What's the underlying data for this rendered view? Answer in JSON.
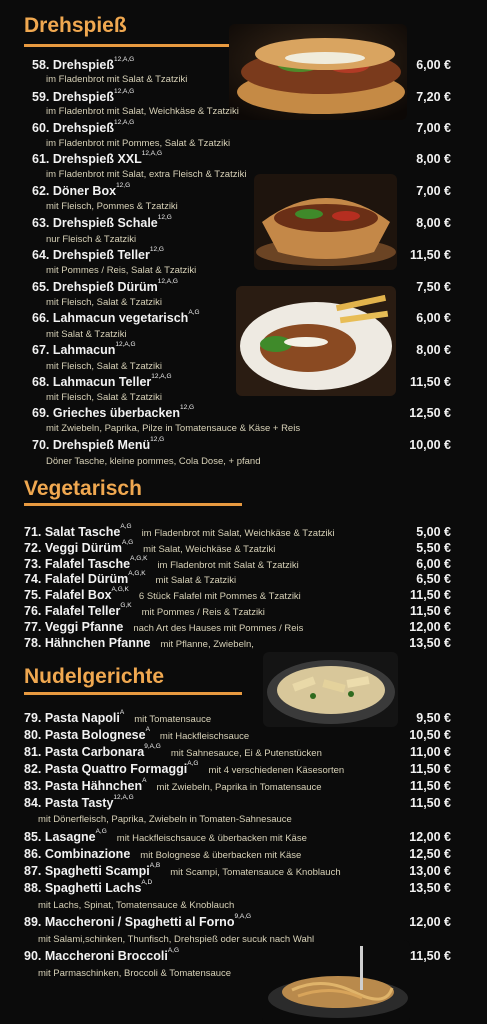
{
  "sections": {
    "drehspiess": "Drehspieß",
    "vegetarisch": "Vegetarisch",
    "nudel": "Nudelgerichte"
  },
  "items": [
    {
      "name": "58. Drehspieß",
      "sup": "12,A,G",
      "desc": "im Fladenbrot mit Salat & Tzatziki",
      "price": "6,00 €"
    },
    {
      "name": "59. Drehspieß",
      "sup": "12,A,G",
      "desc": "im Fladenbrot mit Salat, Weichkäse & Tzatziki",
      "price": "7,20 €"
    },
    {
      "name": "60. Drehspieß",
      "sup": "12,A,G",
      "desc": "im Fladenbrot mit Pommes, Salat & Tzatziki",
      "price": "7,00 €"
    },
    {
      "name": "61. Drehspieß XXL",
      "sup": "12,A,G",
      "desc": "im Fladenbrot mit Salat, extra Fleisch & Tzatziki",
      "price": "8,00 €"
    },
    {
      "name": "62. Döner Box",
      "sup": "12,G",
      "desc": "mit Fleisch, Pommes & Tzatziki",
      "price": "7,00 €"
    },
    {
      "name": "63. Drehspieß Schale",
      "sup": "12,G",
      "desc": "nur Fleisch & Tzatziki",
      "price": "8,00 €"
    },
    {
      "name": "64. Drehspieß Teller",
      "sup": "12,G",
      "desc": "mit Pommes / Reis, Salat & Tzatziki",
      "price": "11,50 €"
    },
    {
      "name": "65. Drehspieß Dürüm",
      "sup": "12,A,G",
      "desc": "mit Fleisch, Salat & Tzatziki",
      "price": "7,50 €"
    },
    {
      "name": "66. Lahmacun vegetarisch",
      "sup": "A,G",
      "desc": "mit Salat & Tzatziki",
      "price": "6,00 €"
    },
    {
      "name": "67. Lahmacun",
      "sup": "12,A,G",
      "desc": "mit Fleisch, Salat & Tzatziki",
      "price": "8,00 €"
    },
    {
      "name": "68. Lahmacun Teller",
      "sup": "12,A,G",
      "desc": "mit Fleisch, Salat & Tzatziki",
      "price": "11,50 €"
    },
    {
      "name": "69. Grieches überbacken",
      "sup": "12,G",
      "desc": "mit Zwiebeln, Paprika, Pilze in Tomatensauce & Käse + Reis",
      "price": "12,50 €"
    },
    {
      "name": "70. Drehspieß Menü",
      "sup": "12,G",
      "desc": "Döner Tasche, kleine pommes, Cola Dose, + pfand",
      "price": "10,00 €"
    },
    {
      "name": "71. Salat Tasche",
      "sup": "A,G",
      "desc": "im Fladenbrot mit Salat, Weichkäse & Tzatziki",
      "price": "5,00 €"
    },
    {
      "name": "72. Veggi Dürüm",
      "sup": "A,G",
      "desc": "mit Salat, Weichkäse & Tzatziki",
      "price": "5,50 €"
    },
    {
      "name": "73. Falafel Tasche",
      "sup": "A,G,K",
      "desc": "im Fladenbrot mit Salat & Tzatziki",
      "price": "6,00 €"
    },
    {
      "name": "74. Falafel Dürüm",
      "sup": "A,G,K",
      "desc": "mit Salat & Tzatziki",
      "price": "6,50 €"
    },
    {
      "name": "75. Falafel Box",
      "sup": "A,G,K",
      "desc": "6 Stück Falafel mit Pommes & Tzatziki",
      "price": "11,50 €"
    },
    {
      "name": "76. Falafel Teller",
      "sup": "G,K",
      "desc": "mit Pommes / Reis & Tzatziki",
      "price": "11,50 €"
    },
    {
      "name": "77. Veggi Pfanne",
      "sup": "",
      "desc": "nach Art des Hauses mit Pommes / Reis",
      "price": "12,00 €"
    },
    {
      "name": "78. Hähnchen Pfanne",
      "sup": "",
      "desc": "mit Pflanne, Zwiebeln,",
      "price": "13,50 €"
    },
    {
      "name": "79. Pasta Napoli",
      "sup": "A",
      "desc": "mit Tomatensauce",
      "price": "9,50 €"
    },
    {
      "name": "80. Pasta Bolognese",
      "sup": "A",
      "desc": "mit Hackfleischsauce",
      "price": "10,50 €"
    },
    {
      "name": "81. Pasta Carbonara",
      "sup": "9,A,G",
      "desc": "mit Sahnesauce, Ei & Putenstücken",
      "price": "11,00 €"
    },
    {
      "name": "82. Pasta Quattro Formaggi",
      "sup": "A,G",
      "desc": "mit 4 verschiedenen Käsesorten",
      "price": "11,50 €"
    },
    {
      "name": "83. Pasta Hähnchen",
      "sup": "A",
      "desc": "mit Zwiebeln, Paprika in Tomatensauce",
      "price": "11,50 €"
    },
    {
      "name": "84. Pasta Tasty",
      "sup": "12,A,G",
      "desc": "mit Dönerfleisch, Paprika, Zwiebeln in Tomaten-Sahnesauce",
      "price": "11,50 €"
    },
    {
      "name": "85. Lasagne",
      "sup": "A,G",
      "desc": "mit Hackfleischsauce & überbacken mit Käse",
      "price": "12,00 €"
    },
    {
      "name": "86. Combinazione",
      "sup": "",
      "desc": "mit Bolognese & überbacken mit Käse",
      "price": "12,50 €"
    },
    {
      "name": "87. Spaghetti Scampi",
      "sup": "A,B",
      "desc": "mit Scampi, Tomatensauce & Knoblauch",
      "price": "13,00 €"
    },
    {
      "name": "88. Spaghetti Lachs",
      "sup": "A,D",
      "desc": "mit Lachs, Spinat, Tomatensauce & Knoblauch",
      "price": "13,50 €"
    },
    {
      "name": "89. Maccheroni / Spaghetti al Forno",
      "sup": "9,A,G",
      "desc": "mit Salami,schinken,  Thunfisch, Drehspieß oder sucuk nach Wahl",
      "price": "12,00 €"
    },
    {
      "name": "90. Maccheroni Broccoli",
      "sup": "A,G",
      "desc": "mit Parmaschinken, Broccoli & Tomatensauce",
      "price": "11,50 €"
    }
  ]
}
